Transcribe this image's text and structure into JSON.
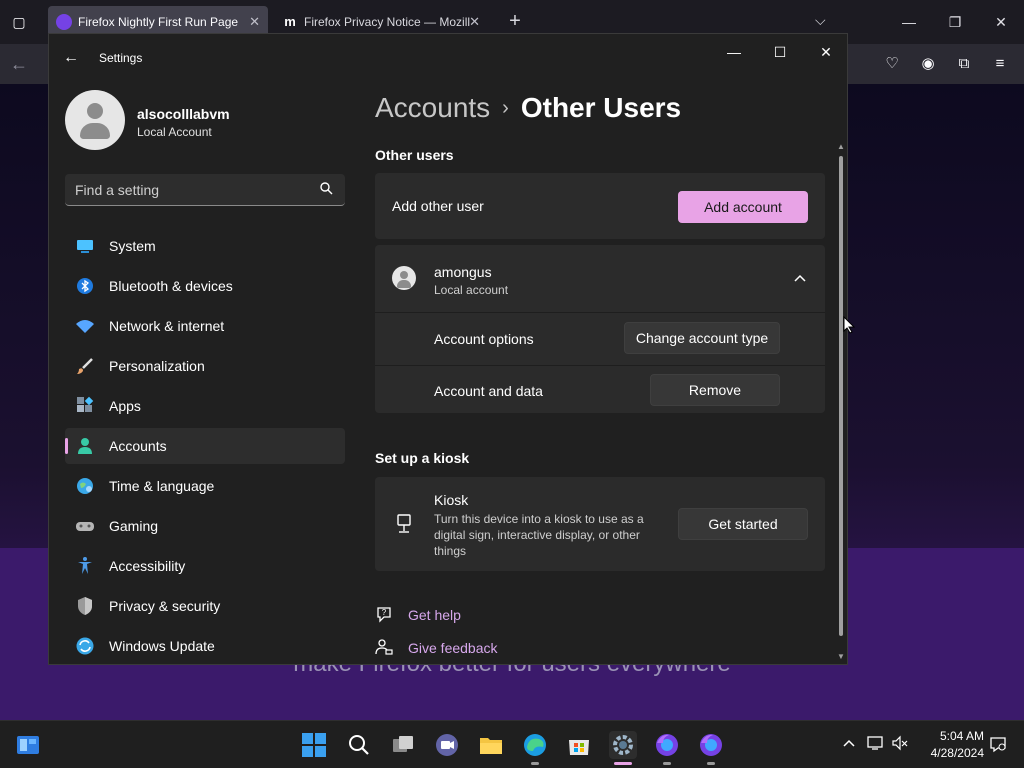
{
  "firefox": {
    "tabs": [
      {
        "label": "Firefox Nightly First Run Page",
        "active": true
      },
      {
        "label": "Firefox Privacy Notice — Mozill",
        "active": false
      }
    ],
    "new_tab_symbol": "+",
    "content_text": "make Firefox better for users everywhere"
  },
  "settings": {
    "title": "Settings",
    "profile": {
      "name": "alsocolllabvm",
      "type": "Local Account"
    },
    "search": {
      "placeholder": "Find a setting"
    },
    "nav": [
      {
        "label": "System",
        "icon": "monitor-icon",
        "color": "#4cc2ff"
      },
      {
        "label": "Bluetooth & devices",
        "icon": "bluetooth-icon",
        "color": "#1f7be0"
      },
      {
        "label": "Network & internet",
        "icon": "wifi-icon",
        "color": "#57a6ff"
      },
      {
        "label": "Personalization",
        "icon": "brush-icon",
        "color": "#e8a36b"
      },
      {
        "label": "Apps",
        "icon": "apps-icon",
        "color": "#a9b7c6"
      },
      {
        "label": "Accounts",
        "icon": "accounts-icon",
        "color": "#38c9a6"
      },
      {
        "label": "Time & language",
        "icon": "globe-icon",
        "color": "#3aa8e8"
      },
      {
        "label": "Gaming",
        "icon": "gamepad-icon",
        "color": "#b5b5b5"
      },
      {
        "label": "Accessibility",
        "icon": "accessibility-icon",
        "color": "#4d9be8"
      },
      {
        "label": "Privacy & security",
        "icon": "shield-icon",
        "color": "#9a9a9a"
      },
      {
        "label": "Windows Update",
        "icon": "update-icon",
        "color": "#3aa8e8"
      }
    ],
    "selected_nav": "Accounts",
    "breadcrumb": {
      "parent": "Accounts",
      "separator": "›",
      "current": "Other Users"
    },
    "other_users": {
      "section_title": "Other users",
      "add_label": "Add other user",
      "add_button": "Add account",
      "user": {
        "name": "amongus",
        "type": "Local account",
        "account_options_label": "Account options",
        "change_type_button": "Change account type",
        "account_data_label": "Account and data",
        "remove_button": "Remove"
      }
    },
    "kiosk": {
      "section_title": "Set up a kiosk",
      "title": "Kiosk",
      "description": "Turn this device into a kiosk to use as a digital sign, interactive display, or other things",
      "button": "Get started"
    },
    "links": {
      "help": "Get help",
      "feedback": "Give feedback"
    }
  },
  "taskbar": {
    "time": "5:04 AM",
    "date": "4/28/2024"
  },
  "colors": {
    "accent": "#e8a3e6"
  }
}
